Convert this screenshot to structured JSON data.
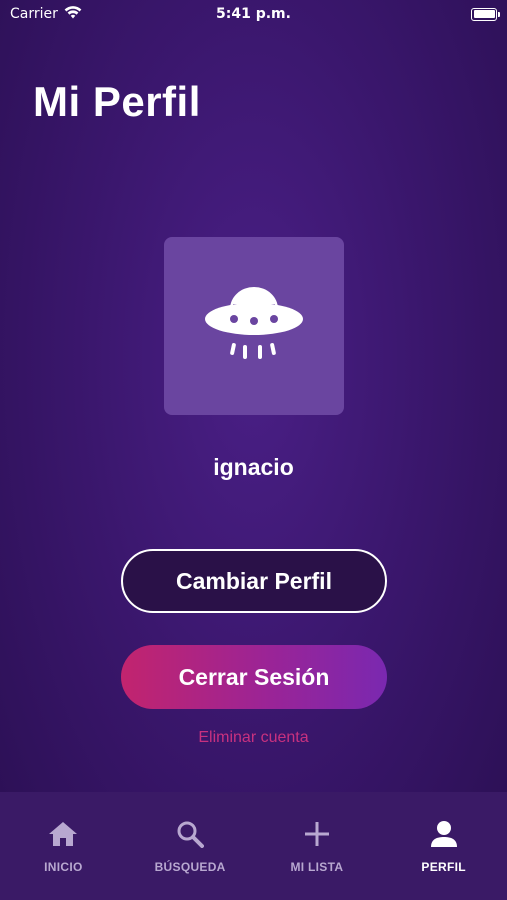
{
  "status_bar": {
    "carrier": "Carrier",
    "time": "5:41 p.m."
  },
  "header": {
    "title": "Mi Perfil"
  },
  "profile": {
    "avatar_icon": "ufo-icon",
    "username": "ignacio"
  },
  "actions": {
    "change_profile_label": "Cambiar Perfil",
    "logout_label": "Cerrar Sesión",
    "delete_account_label": "Eliminar cuenta"
  },
  "tab_bar": {
    "items": [
      {
        "label": "INICIO",
        "icon": "home-icon",
        "active": false
      },
      {
        "label": "BÚSQUEDA",
        "icon": "search-icon",
        "active": false
      },
      {
        "label": "MI LISTA",
        "icon": "plus-icon",
        "active": false
      },
      {
        "label": "PERFIL",
        "icon": "person-icon",
        "active": true
      }
    ]
  },
  "colors": {
    "background": "#3b176e",
    "avatar_bg": "#6a45a0",
    "logout_gradient_start": "#c2246e",
    "logout_gradient_end": "#7a28b0",
    "delete_link": "#c8317f",
    "tab_bar_bg": "#3a1a66"
  }
}
